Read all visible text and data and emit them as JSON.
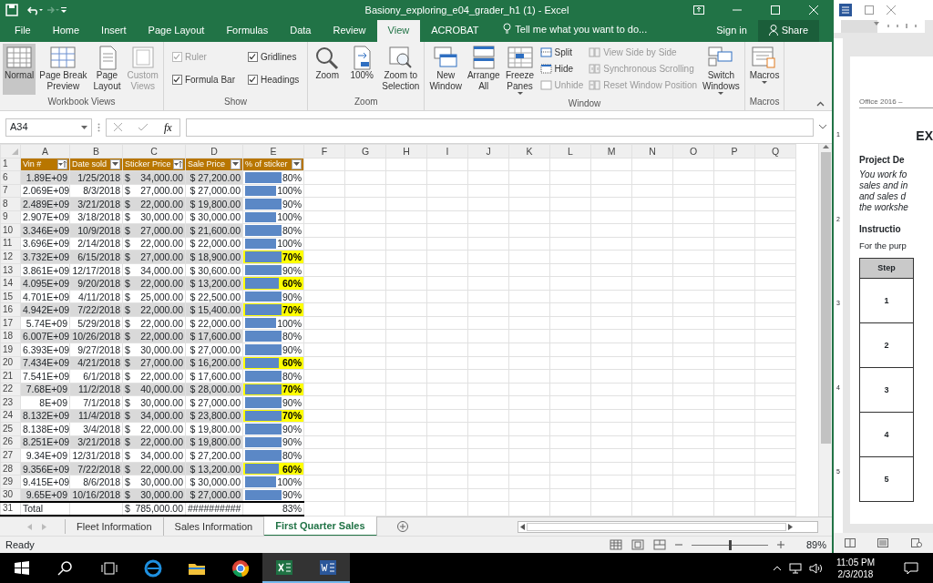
{
  "window": {
    "title": "Basiony_exploring_e04_grader_h1 (1) - Excel"
  },
  "menu_tabs": [
    {
      "label": "File",
      "selected": false
    },
    {
      "label": "Home",
      "selected": false
    },
    {
      "label": "Insert",
      "selected": false
    },
    {
      "label": "Page Layout",
      "selected": false
    },
    {
      "label": "Formulas",
      "selected": false
    },
    {
      "label": "Data",
      "selected": false
    },
    {
      "label": "Review",
      "selected": false
    },
    {
      "label": "View",
      "selected": true
    },
    {
      "label": "ACROBAT",
      "selected": false
    }
  ],
  "tell_me": {
    "placeholder": "Tell me what you want to do..."
  },
  "sign_in": "Sign in",
  "share": "Share",
  "ribbon": {
    "groups": [
      {
        "label": "Workbook Views",
        "items": [
          {
            "kind": "large",
            "lines": [
              "Normal"
            ],
            "selected": true,
            "disabled": false
          },
          {
            "kind": "large",
            "lines": [
              "Page Break",
              "Preview"
            ],
            "selected": false,
            "disabled": false
          },
          {
            "kind": "large",
            "lines": [
              "Page",
              "Layout"
            ],
            "selected": false,
            "disabled": false
          },
          {
            "kind": "large",
            "lines": [
              "Custom",
              "Views"
            ],
            "selected": false,
            "disabled": true
          }
        ]
      },
      {
        "label": "Show",
        "items": [
          {
            "kind": "check",
            "label": "Ruler",
            "checked": true,
            "disabled": true
          },
          {
            "kind": "check",
            "label": "Formula Bar",
            "checked": true,
            "disabled": false
          },
          {
            "kind": "check",
            "label": "Gridlines",
            "checked": true,
            "disabled": false
          },
          {
            "kind": "check",
            "label": "Headings",
            "checked": true,
            "disabled": false
          }
        ]
      },
      {
        "label": "Zoom",
        "items": [
          {
            "kind": "large",
            "lines": [
              "Zoom"
            ],
            "selected": false,
            "disabled": false
          },
          {
            "kind": "large",
            "lines": [
              "100%"
            ],
            "selected": false,
            "disabled": false
          },
          {
            "kind": "large",
            "lines": [
              "Zoom to",
              "Selection"
            ],
            "selected": false,
            "disabled": false
          }
        ]
      },
      {
        "label": "Window",
        "items": [
          {
            "kind": "large",
            "lines": [
              "New",
              "Window"
            ],
            "selected": false,
            "disabled": false
          },
          {
            "kind": "large",
            "lines": [
              "Arrange",
              "All"
            ],
            "selected": false,
            "disabled": false
          },
          {
            "kind": "large",
            "lines": [
              "Freeze",
              "Panes"
            ],
            "selected": false,
            "disabled": false,
            "dropdown": true
          },
          {
            "kind": "small",
            "label": "Split",
            "disabled": false
          },
          {
            "kind": "small",
            "label": "Hide",
            "disabled": false
          },
          {
            "kind": "small",
            "label": "Unhide",
            "disabled": true
          },
          {
            "kind": "small",
            "label": "View Side by Side",
            "disabled": true
          },
          {
            "kind": "small",
            "label": "Synchronous Scrolling",
            "disabled": true
          },
          {
            "kind": "small",
            "label": "Reset Window Position",
            "disabled": true
          },
          {
            "kind": "large",
            "lines": [
              "Switch",
              "Windows"
            ],
            "selected": false,
            "disabled": false,
            "dropdown": true
          }
        ]
      },
      {
        "label": "Macros",
        "items": [
          {
            "kind": "large",
            "lines": [
              "Macros"
            ],
            "selected": false,
            "disabled": false,
            "dropdown": true
          }
        ]
      }
    ]
  },
  "formula_bar": {
    "name_box": "A34",
    "fx": "fx"
  },
  "columns": [
    "A",
    "B",
    "C",
    "D",
    "E",
    "F",
    "G",
    "H",
    "I",
    "J",
    "K",
    "L",
    "M",
    "N",
    "O",
    "P",
    "Q"
  ],
  "header_row": {
    "row": "1",
    "cells": [
      {
        "label": "Vin #",
        "kind": "sort"
      },
      {
        "label": "Date sold",
        "kind": "filter"
      },
      {
        "label": "Sticker Price",
        "kind": "sort"
      },
      {
        "label": "Sale Price",
        "kind": "filter"
      },
      {
        "label": "% of sticker",
        "kind": "filter"
      }
    ]
  },
  "rows": [
    {
      "row": "6",
      "vin": "1.89E+09",
      "date": "1/25/2018",
      "sticker_symbol": "$",
      "sticker": "34,000.00",
      "sale": "$ 27,200.00",
      "pct": "80%",
      "level": 0.8,
      "highlighted": false
    },
    {
      "row": "7",
      "vin": "2.069E+09",
      "date": "8/3/2018",
      "sticker_symbol": "$",
      "sticker": "27,000.00",
      "sale": "$ 27,000.00",
      "pct": "100%",
      "level": 1.0,
      "highlighted": false
    },
    {
      "row": "8",
      "vin": "2.489E+09",
      "date": "3/21/2018",
      "sticker_symbol": "$",
      "sticker": "22,000.00",
      "sale": "$ 19,800.00",
      "pct": "90%",
      "level": 0.9,
      "highlighted": false
    },
    {
      "row": "9",
      "vin": "2.907E+09",
      "date": "3/18/2018",
      "sticker_symbol": "$",
      "sticker": "30,000.00",
      "sale": "$ 30,000.00",
      "pct": "100%",
      "level": 1.0,
      "highlighted": false
    },
    {
      "row": "10",
      "vin": "3.346E+09",
      "date": "10/9/2018",
      "sticker_symbol": "$",
      "sticker": "27,000.00",
      "sale": "$ 21,600.00",
      "pct": "80%",
      "level": 0.8,
      "highlighted": false
    },
    {
      "row": "11",
      "vin": "3.696E+09",
      "date": "2/14/2018",
      "sticker_symbol": "$",
      "sticker": "22,000.00",
      "sale": "$ 22,000.00",
      "pct": "100%",
      "level": 1.0,
      "highlighted": false
    },
    {
      "row": "12",
      "vin": "3.732E+09",
      "date": "6/15/2018",
      "sticker_symbol": "$",
      "sticker": "27,000.00",
      "sale": "$ 18,900.00",
      "pct": "70%",
      "level": 0.7,
      "highlighted": true
    },
    {
      "row": "13",
      "vin": "3.861E+09",
      "date": "12/17/2018",
      "sticker_symbol": "$",
      "sticker": "34,000.00",
      "sale": "$ 30,600.00",
      "pct": "90%",
      "level": 0.9,
      "highlighted": false
    },
    {
      "row": "14",
      "vin": "4.095E+09",
      "date": "9/20/2018",
      "sticker_symbol": "$",
      "sticker": "22,000.00",
      "sale": "$ 13,200.00",
      "pct": "60%",
      "level": 0.6,
      "highlighted": true
    },
    {
      "row": "15",
      "vin": "4.701E+09",
      "date": "4/11/2018",
      "sticker_symbol": "$",
      "sticker": "25,000.00",
      "sale": "$ 22,500.00",
      "pct": "90%",
      "level": 0.9,
      "highlighted": false
    },
    {
      "row": "16",
      "vin": "4.942E+09",
      "date": "7/22/2018",
      "sticker_symbol": "$",
      "sticker": "22,000.00",
      "sale": "$ 15,400.00",
      "pct": "70%",
      "level": 0.7,
      "highlighted": true
    },
    {
      "row": "17",
      "vin": "5.74E+09",
      "date": "5/29/2018",
      "sticker_symbol": "$",
      "sticker": "22,000.00",
      "sale": "$ 22,000.00",
      "pct": "100%",
      "level": 1.0,
      "highlighted": false
    },
    {
      "row": "18",
      "vin": "6.007E+09",
      "date": "10/26/2018",
      "sticker_symbol": "$",
      "sticker": "22,000.00",
      "sale": "$ 17,600.00",
      "pct": "80%",
      "level": 0.8,
      "highlighted": false
    },
    {
      "row": "19",
      "vin": "6.393E+09",
      "date": "9/27/2018",
      "sticker_symbol": "$",
      "sticker": "30,000.00",
      "sale": "$ 27,000.00",
      "pct": "90%",
      "level": 0.9,
      "highlighted": false
    },
    {
      "row": "20",
      "vin": "7.434E+09",
      "date": "4/21/2018",
      "sticker_symbol": "$",
      "sticker": "27,000.00",
      "sale": "$ 16,200.00",
      "pct": "60%",
      "level": 0.6,
      "highlighted": true
    },
    {
      "row": "21",
      "vin": "7.541E+09",
      "date": "6/1/2018",
      "sticker_symbol": "$",
      "sticker": "22,000.00",
      "sale": "$ 17,600.00",
      "pct": "80%",
      "level": 0.8,
      "highlighted": false
    },
    {
      "row": "22",
      "vin": "7.68E+09",
      "date": "11/2/2018",
      "sticker_symbol": "$",
      "sticker": "40,000.00",
      "sale": "$ 28,000.00",
      "pct": "70%",
      "level": 0.7,
      "highlighted": true
    },
    {
      "row": "23",
      "vin": "8E+09",
      "date": "7/1/2018",
      "sticker_symbol": "$",
      "sticker": "30,000.00",
      "sale": "$ 27,000.00",
      "pct": "90%",
      "level": 0.9,
      "highlighted": false
    },
    {
      "row": "24",
      "vin": "8.132E+09",
      "date": "11/4/2018",
      "sticker_symbol": "$",
      "sticker": "34,000.00",
      "sale": "$ 23,800.00",
      "pct": "70%",
      "level": 0.7,
      "highlighted": true
    },
    {
      "row": "25",
      "vin": "8.138E+09",
      "date": "3/4/2018",
      "sticker_symbol": "$",
      "sticker": "22,000.00",
      "sale": "$ 19,800.00",
      "pct": "90%",
      "level": 0.9,
      "highlighted": false
    },
    {
      "row": "26",
      "vin": "8.251E+09",
      "date": "3/21/2018",
      "sticker_symbol": "$",
      "sticker": "22,000.00",
      "sale": "$ 19,800.00",
      "pct": "90%",
      "level": 0.9,
      "highlighted": false
    },
    {
      "row": "27",
      "vin": "9.34E+09",
      "date": "12/31/2018",
      "sticker_symbol": "$",
      "sticker": "34,000.00",
      "sale": "$ 27,200.00",
      "pct": "80%",
      "level": 0.8,
      "highlighted": false
    },
    {
      "row": "28",
      "vin": "9.356E+09",
      "date": "7/22/2018",
      "sticker_symbol": "$",
      "sticker": "22,000.00",
      "sale": "$ 13,200.00",
      "pct": "60%",
      "level": 0.6,
      "highlighted": true
    },
    {
      "row": "29",
      "vin": "9.415E+09",
      "date": "8/6/2018",
      "sticker_symbol": "$",
      "sticker": "30,000.00",
      "sale": "$ 30,000.00",
      "pct": "100%",
      "level": 1.0,
      "highlighted": false
    },
    {
      "row": "30",
      "vin": "9.65E+09",
      "date": "10/16/2018",
      "sticker_symbol": "$",
      "sticker": "30,000.00",
      "sale": "$ 27,000.00",
      "pct": "90%",
      "level": 0.9,
      "highlighted": false
    }
  ],
  "total_row": {
    "row": "31",
    "label": "Total",
    "sticker_symbol": "$",
    "sticker": "785,000.00",
    "sale": "##########",
    "pct": "83%"
  },
  "sheet_tabs": [
    {
      "label": "Fleet Information",
      "selected": false
    },
    {
      "label": "Sales Information",
      "selected": false
    },
    {
      "label": "First Quarter Sales",
      "selected": true
    }
  ],
  "status_bar": {
    "mode": "Ready",
    "zoom": {
      "level": 0.5
    },
    "zoom_text": "89%"
  },
  "word_pane": {
    "header": "Office 2016 –",
    "title": "EX",
    "heading": "Project De",
    "italic_lines": [
      "You work fo",
      "sales and in",
      "and sales d",
      "the workshe"
    ],
    "instructions": "Instructio",
    "intro": "For the purp",
    "table_header": "Step",
    "steps": [
      "1",
      "2",
      "3",
      "4",
      "5"
    ],
    "ruler_numbers": [
      "1",
      "2",
      "3",
      "4",
      "5"
    ]
  },
  "taskbar": {
    "time": "11:05 PM",
    "date": "2/3/2018"
  }
}
